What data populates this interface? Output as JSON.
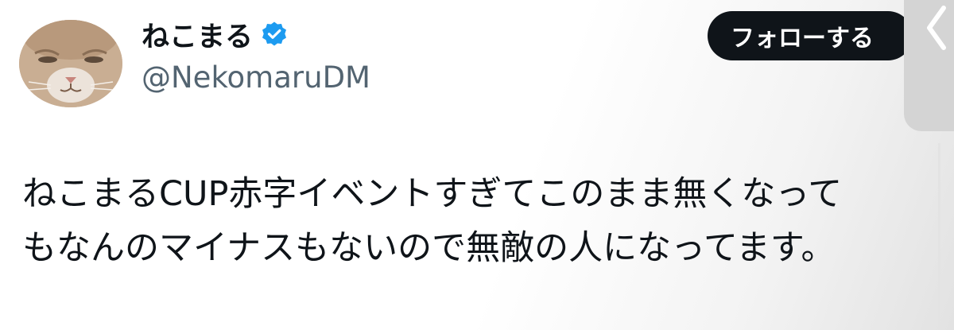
{
  "user": {
    "display_name": "ねこまる",
    "handle": "@NekomaruDM",
    "avatar_icon": "cat-avatar",
    "verified_icon": "verified-badge-icon",
    "verified_color": "#1d9bf0"
  },
  "follow_button": {
    "label": "フォローする",
    "background": "#0f1419",
    "text_color": "#ffffff"
  },
  "tweet": {
    "text": "ねこまるCUP赤字イベントすぎてこのまま無くなって\nもなんのマイナスもないので無敵の人になってます。"
  },
  "colors": {
    "text_primary": "#0f1419",
    "text_secondary": "#536471"
  }
}
